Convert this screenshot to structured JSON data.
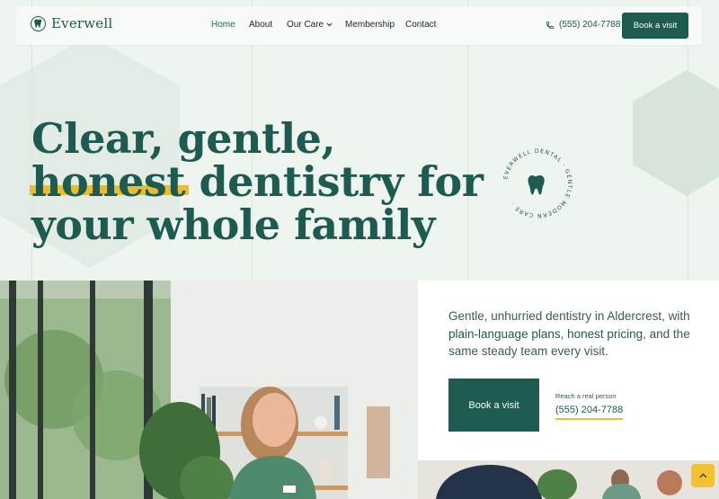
{
  "brand": {
    "name": "Everwell"
  },
  "nav": {
    "links": [
      {
        "label": "Home"
      },
      {
        "label": "About"
      },
      {
        "label": "Our Care"
      },
      {
        "label": "Membership"
      },
      {
        "label": "Contact"
      }
    ],
    "phone": "(555) 204-7788",
    "cta": "Book a visit"
  },
  "hero": {
    "line1": "Clear, gentle,",
    "line2_highlight": "honest",
    "line2_rest": " dentistry for",
    "line3": "your whole family"
  },
  "badge": {
    "ring_text": "EVERWELL DENTAL · GENTLE MODERN CARE ·"
  },
  "intro": {
    "part1": "Gentle, unhurried dentistry in Aldercrest, with ",
    "emphasis": "plain-language plans, honest pricing,",
    "part2": " and the same steady team every visit."
  },
  "card": {
    "cta": "Book a visit",
    "reach_label": "Reach a real person",
    "phone": "(555) 204-7788"
  },
  "colors": {
    "primary": "#1d5a4f",
    "accent": "#e8bd32",
    "background": "#eef4ee"
  },
  "icons": {
    "phone": "phone-icon",
    "tooth": "tooth-icon",
    "chevron": "chevron-down-icon",
    "up": "arrow-up-icon"
  }
}
